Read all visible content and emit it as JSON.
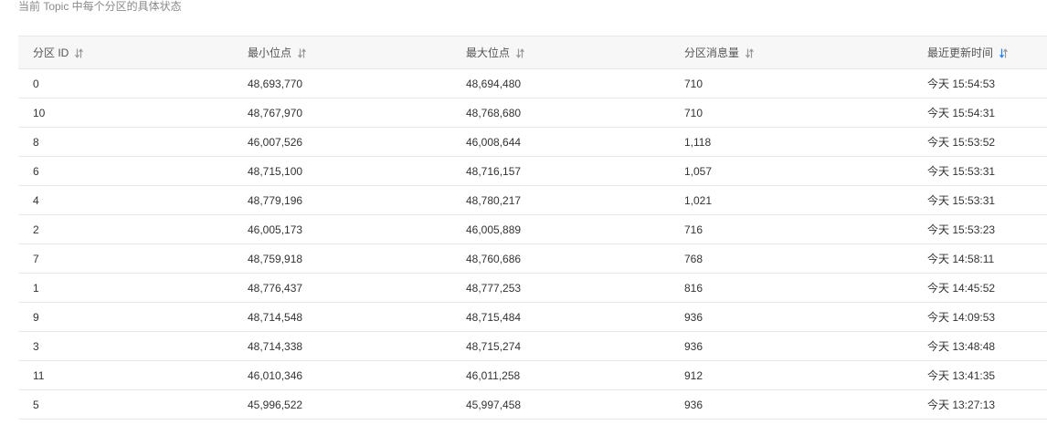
{
  "caption": "当前 Topic 中每个分区的具体状态",
  "table": {
    "columns": [
      {
        "label": "分区 ID",
        "sort": "none"
      },
      {
        "label": "最小位点",
        "sort": "none"
      },
      {
        "label": "最大位点",
        "sort": "none"
      },
      {
        "label": "分区消息量",
        "sort": "none"
      },
      {
        "label": "最近更新时间",
        "sort": "desc"
      }
    ],
    "rows": [
      [
        "0",
        "48,693,770",
        "48,694,480",
        "710",
        "今天 15:54:53"
      ],
      [
        "10",
        "48,767,970",
        "48,768,680",
        "710",
        "今天 15:54:31"
      ],
      [
        "8",
        "46,007,526",
        "46,008,644",
        "1,118",
        "今天 15:53:52"
      ],
      [
        "6",
        "48,715,100",
        "48,716,157",
        "1,057",
        "今天 15:53:31"
      ],
      [
        "4",
        "48,779,196",
        "48,780,217",
        "1,021",
        "今天 15:53:31"
      ],
      [
        "2",
        "46,005,173",
        "46,005,889",
        "716",
        "今天 15:53:23"
      ],
      [
        "7",
        "48,759,918",
        "48,760,686",
        "768",
        "今天 14:58:11"
      ],
      [
        "1",
        "48,776,437",
        "48,777,253",
        "816",
        "今天 14:45:52"
      ],
      [
        "9",
        "48,714,548",
        "48,715,484",
        "936",
        "今天 14:09:53"
      ],
      [
        "3",
        "48,714,338",
        "48,715,274",
        "936",
        "今天 13:48:48"
      ],
      [
        "11",
        "46,010,346",
        "46,011,258",
        "912",
        "今天 13:41:35"
      ],
      [
        "5",
        "45,996,522",
        "45,997,458",
        "936",
        "今天 13:27:13"
      ]
    ]
  },
  "colors": {
    "sort_inactive": "#999999",
    "sort_active": "#1e80ff"
  },
  "icons": {
    "sort": "sort-arrows-icon"
  }
}
